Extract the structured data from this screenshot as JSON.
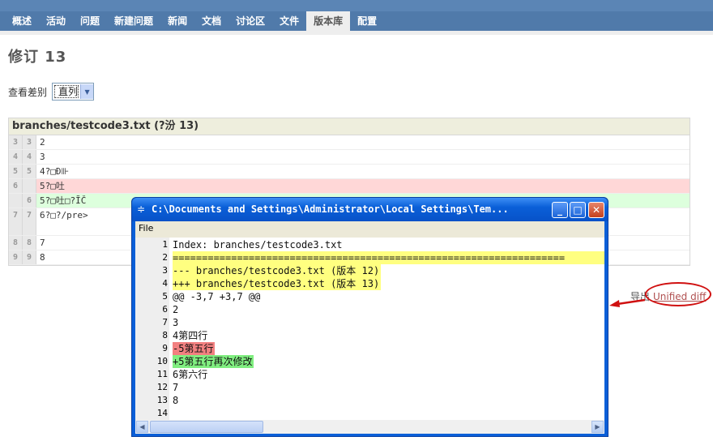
{
  "nav": {
    "tabs": [
      {
        "label": "概述",
        "selected": false
      },
      {
        "label": "活动",
        "selected": false
      },
      {
        "label": "问题",
        "selected": false
      },
      {
        "label": "新建问题",
        "selected": false
      },
      {
        "label": "新闻",
        "selected": false
      },
      {
        "label": "文档",
        "selected": false
      },
      {
        "label": "讨论区",
        "selected": false
      },
      {
        "label": "文件",
        "selected": false
      },
      {
        "label": "版本库",
        "selected": true
      },
      {
        "label": "配置",
        "selected": false
      }
    ]
  },
  "page": {
    "title": "修订 13",
    "diff_label": "查看差别",
    "diff_mode": "直列"
  },
  "diff": {
    "file_header": "branches/testcode3.txt (?汾 13)",
    "rows": [
      {
        "old": "3",
        "new": "3",
        "text": "2",
        "type": "ctx"
      },
      {
        "old": "4",
        "new": "4",
        "text": "3",
        "type": "ctx"
      },
      {
        "old": "5",
        "new": "5",
        "text": "4?□Ð⊪",
        "type": "ctx"
      },
      {
        "old": "6",
        "new": "",
        "text": "5?□吐",
        "type": "del"
      },
      {
        "old": "",
        "new": "6",
        "text": "5?□吐□?ĨČ",
        "type": "ins"
      },
      {
        "old": "7",
        "new": "7",
        "text": "6?□?/pre>",
        "type": "ctx"
      },
      {
        "old": "8",
        "new": "8",
        "text": "7",
        "type": "ctx"
      },
      {
        "old": "9",
        "new": "9",
        "text": "8",
        "type": "ctx"
      }
    ]
  },
  "export": {
    "label": "导出",
    "link": "Unified diff"
  },
  "window": {
    "title": "C:\\Documents and Settings\\Administrator\\Local Settings\\Tem...",
    "menu": "File",
    "lines": [
      {
        "n": "1",
        "t": "Index: branches/testcode3.txt",
        "s": ""
      },
      {
        "n": "2",
        "t": "===================================================================",
        "s": "y"
      },
      {
        "n": "3",
        "t": "--- branches/testcode3.txt  (版本 12)",
        "s": "yb"
      },
      {
        "n": "4",
        "t": "+++ branches/testcode3.txt  (版本 13)",
        "s": "yb"
      },
      {
        "n": "5",
        "t": "@@ -3,7 +3,7 @@",
        "s": "red"
      },
      {
        "n": "6",
        "t": " 2",
        "s": ""
      },
      {
        "n": "7",
        "t": " 3",
        "s": ""
      },
      {
        "n": "8",
        "t": " 4第四行",
        "s": ""
      },
      {
        "n": "9",
        "t": "-5第五行",
        "s": "r"
      },
      {
        "n": "10",
        "t": "+5第五行再次修改",
        "s": "g"
      },
      {
        "n": "11",
        "t": " 6第六行",
        "s": ""
      },
      {
        "n": "12",
        "t": " 7",
        "s": ""
      },
      {
        "n": "13",
        "t": " 8",
        "s": ""
      },
      {
        "n": "14",
        "t": "",
        "s": ""
      }
    ]
  },
  "colors": {
    "nav_bg": "#507aaa",
    "del_bg": "#ffd7d7",
    "ins_bg": "#ddffdd",
    "highlight_yellow": "#ffff80",
    "annotation_red": "#d01010"
  }
}
